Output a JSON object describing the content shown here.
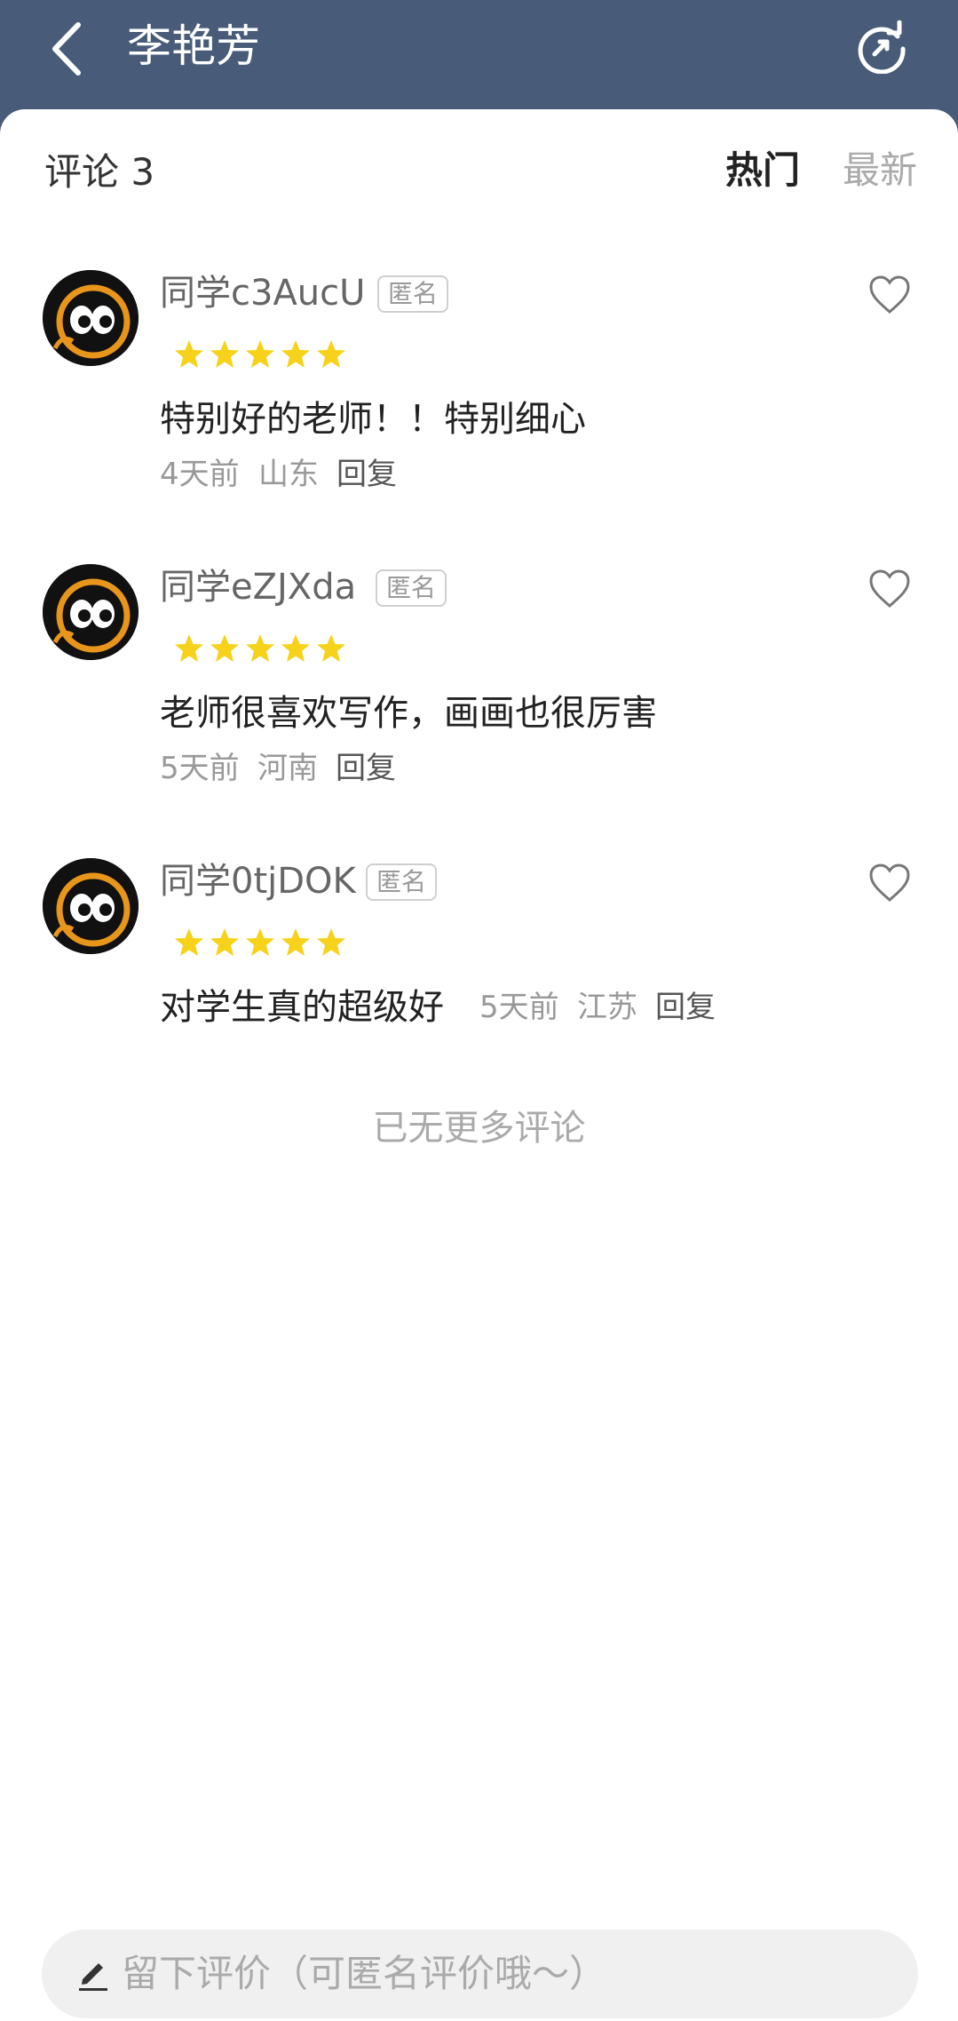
{
  "header": {
    "title": "李艳芳",
    "back_icon": "chevron-left-icon",
    "refresh_icon": "refresh-icon"
  },
  "comments_header": {
    "count_label": "评论 3",
    "tabs": [
      {
        "label": "热门",
        "active": true
      },
      {
        "label": "最新",
        "active": false
      }
    ]
  },
  "comments": [
    {
      "username": "同学c3AucU",
      "badge": "匿名",
      "rating": 5,
      "text": "特别好的老师！！特别细心",
      "time": "4天前",
      "location": "山东",
      "reply_label": "回复"
    },
    {
      "username": "同学eZJXda",
      "badge": "匿名",
      "rating": 5,
      "text": "老师很喜欢写作，画画也很厉害",
      "time": "5天前",
      "location": "河南",
      "reply_label": "回复"
    },
    {
      "username": "同学0tjDOK",
      "badge": "匿名",
      "rating": 5,
      "text": "对学生真的超级好",
      "time": "5天前",
      "location": "江苏",
      "reply_label": "回复"
    }
  ],
  "footer_note": "已无更多评论",
  "comment_input": {
    "placeholder": "留下评价（可匿名评价哦～）"
  },
  "colors": {
    "header_bg": "#485b79",
    "star": "#f7d21b",
    "text_primary": "#222222",
    "text_secondary": "#999999"
  }
}
